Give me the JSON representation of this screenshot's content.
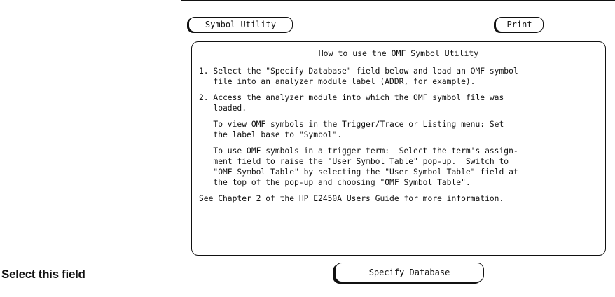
{
  "top_buttons": {
    "symbol_utility_label": "Symbol Utility",
    "print_label": "Print"
  },
  "help": {
    "title": "How to use the OMF Symbol Utility",
    "paragraphs": [
      "1. Select the \"Specify Database\" field below and load an OMF symbol\n   file into an analyzer module label (ADDR, for example).",
      "2. Access the analyzer module into which the OMF symbol file was\n   loaded.",
      "   To view OMF symbols in the Trigger/Trace or Listing menu: Set\n   the label base to \"Symbol\".",
      "   To use OMF symbols in a trigger term:  Select the term's assign-\n   ment field to raise the \"User Symbol Table\" pop-up.  Switch to\n   \"OMF Symbol Table\" by selecting the \"User Symbol Table\" field at\n   the top of the pop-up and choosing \"OMF Symbol Table\"."
    ],
    "footer": "See Chapter 2 of the HP E2450A Users Guide for more information."
  },
  "specify_database_label": "Specify Database",
  "callout_label": "Select this field"
}
